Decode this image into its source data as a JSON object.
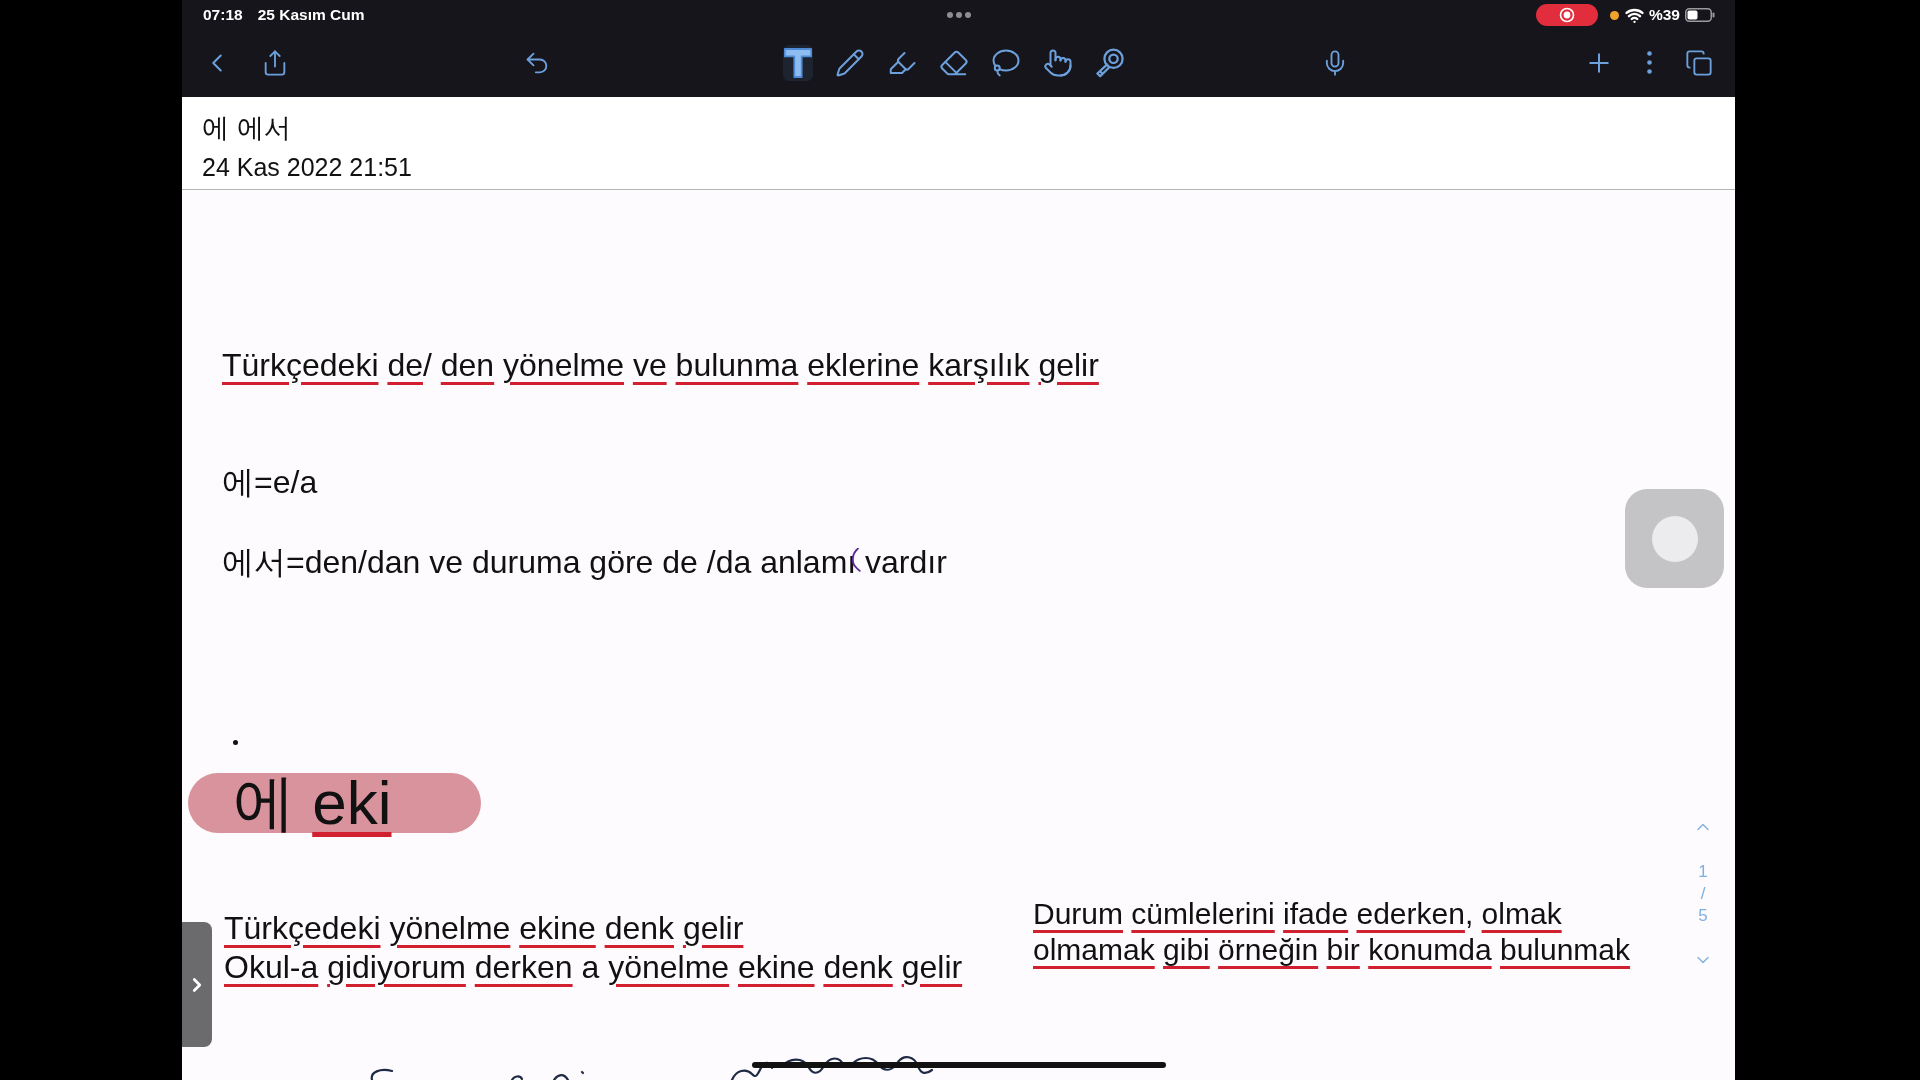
{
  "status_bar": {
    "time": "07:18",
    "date": "25 Kasım Cum",
    "battery": "%39"
  },
  "toolbar": {
    "tools": [
      {
        "kind": "text",
        "selected": true
      },
      {
        "kind": "pen",
        "selected": false
      },
      {
        "kind": "highlighter",
        "selected": false
      },
      {
        "kind": "eraser",
        "selected": false
      },
      {
        "kind": "lasso",
        "selected": false
      },
      {
        "kind": "pointer",
        "selected": false
      },
      {
        "kind": "laser",
        "selected": false
      }
    ]
  },
  "note": {
    "title": "에 에서",
    "date": "24 Kas 2022 21:51"
  },
  "body": {
    "lines": [
      {
        "words": [
          {
            "text": "Türkçedeki",
            "misspelled": true
          },
          {
            "text": "de",
            "misspelled": true,
            "suffix": "/"
          },
          {
            "text": "den",
            "misspelled": true
          },
          {
            "text": "yönelme",
            "misspelled": true
          },
          {
            "text": "ve",
            "misspelled": true
          },
          {
            "text": "bulunma",
            "misspelled": true
          },
          {
            "text": "eklerine",
            "misspelled": true
          },
          {
            "text": "karşılık",
            "misspelled": true
          },
          {
            "text": "gelir",
            "misspelled": true
          }
        ]
      },
      {
        "words": [
          {
            "text": "에=e/a",
            "misspelled": false
          }
        ]
      },
      {
        "words": [
          {
            "text": "에서=den/dan ve duruma göre de /da anlamı vardır",
            "misspelled": false
          }
        ],
        "ink_mark": true
      }
    ],
    "heading": {
      "words": [
        {
          "text": "에",
          "misspelled": false
        },
        {
          "text": "eki",
          "misspelled": true
        }
      ]
    },
    "left_block": {
      "lines": [
        {
          "words": [
            {
              "text": "Türkçedeki",
              "misspelled": true
            },
            {
              "text": "yönelme",
              "misspelled": true
            },
            {
              "text": "ekine",
              "misspelled": true
            },
            {
              "text": "denk",
              "misspelled": true
            },
            {
              "text": "gelir",
              "misspelled": true
            }
          ]
        },
        {
          "words": [
            {
              "text": "Okul-a",
              "misspelled": true
            },
            {
              "text": "gidiyorum",
              "misspelled": true
            },
            {
              "text": "derken",
              "misspelled": true
            },
            {
              "text": "a",
              "misspelled": false
            },
            {
              "text": "yönelme",
              "misspelled": true
            },
            {
              "text": "ekine",
              "misspelled": true
            },
            {
              "text": "denk",
              "misspelled": true
            },
            {
              "text": "gelir",
              "misspelled": true
            }
          ]
        }
      ]
    },
    "right_block": {
      "lines": [
        {
          "words": [
            {
              "text": "Durum",
              "misspelled": true
            },
            {
              "text": "cümlelerini",
              "misspelled": true
            },
            {
              "text": "ifade",
              "misspelled": true
            },
            {
              "text": "ederken",
              "misspelled": true,
              "suffix": ","
            },
            {
              "text": "olmak",
              "misspelled": true
            }
          ]
        },
        {
          "words": [
            {
              "text": "olmamak",
              "misspelled": true
            },
            {
              "text": "gibi",
              "misspelled": true
            },
            {
              "text": "örneğin",
              "misspelled": true
            },
            {
              "text": "bir",
              "misspelled": true
            },
            {
              "text": "konumda",
              "misspelled": true
            },
            {
              "text": "bulunmak",
              "misspelled": true
            }
          ]
        }
      ]
    }
  },
  "page_indicator": {
    "current": "1",
    "separator": "/",
    "total": "5"
  }
}
